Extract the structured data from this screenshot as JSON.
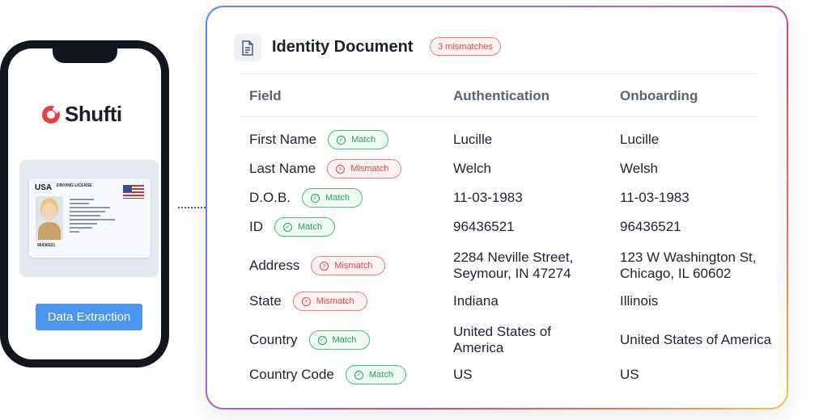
{
  "phone": {
    "brand": "Shufti",
    "id_card": {
      "country": "USA",
      "type": "DRIVING LICENSE",
      "number": "96436521"
    },
    "extract_button": "Data Extraction"
  },
  "panel": {
    "title": "Identity Document",
    "mismatch_badge": "3 mismatches",
    "headers": {
      "field": "Field",
      "auth": "Authentication",
      "onboarding": "Onboarding"
    },
    "status_colors": {
      "match": "#27a35b",
      "mismatch": "#e14747"
    },
    "rows": [
      {
        "field": "First Name",
        "status": "Match",
        "auth": "Lucille",
        "onboarding": "Lucille"
      },
      {
        "field": "Last Name",
        "status": "Mismatch",
        "auth": "Welch",
        "onboarding": "Welsh"
      },
      {
        "field": "D.O.B.",
        "status": "Match",
        "auth": "11-03-1983",
        "onboarding": "11-03-1983"
      },
      {
        "field": "ID",
        "status": "Match",
        "auth": "96436521",
        "onboarding": "96436521"
      },
      {
        "field": "Address",
        "status": "Mismatch",
        "auth": "2284 Neville Street, Seymour, IN 47274",
        "onboarding": "123 W Washington St, Chicago, IL 60602"
      },
      {
        "field": "State",
        "status": "Mismatch",
        "auth": "Indiana",
        "onboarding": "Illinois"
      },
      {
        "field": "Country",
        "status": "Match",
        "auth": "United States of America",
        "onboarding": "United States of America"
      },
      {
        "field": "Country Code",
        "status": "Match",
        "auth": "US",
        "onboarding": "US"
      }
    ]
  }
}
